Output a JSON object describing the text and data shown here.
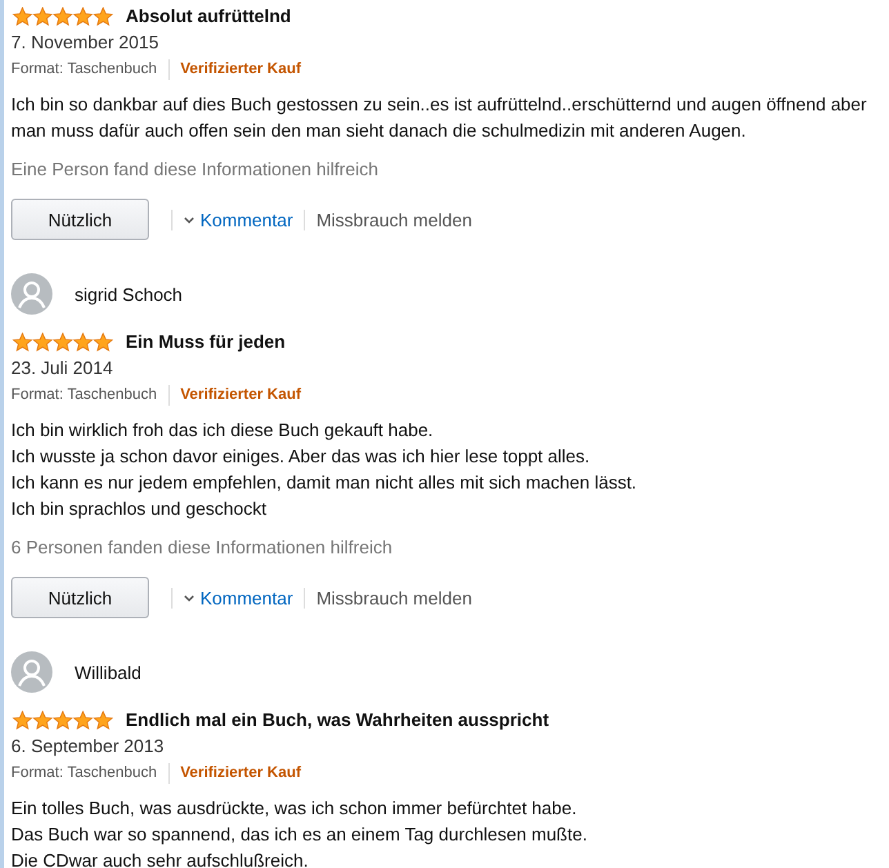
{
  "reviews": [
    {
      "stars": 5,
      "title": "Absolut aufrüttelnd",
      "date": "7. November 2015",
      "format": "Format: Taschenbuch",
      "verified": "Verifizierter Kauf",
      "body": [
        "Ich bin so dankbar auf dies Buch gestossen zu sein..es ist aufrüttelnd..erschütternd und augen öffnend aber",
        "man muss dafür auch offen sein den man sieht danach die schulmedizin mit anderen Augen."
      ],
      "helpful_text": "Eine Person fand diese Informationen hilfreich",
      "helpful_button": "Nützlich",
      "comment_link": "Kommentar",
      "report_link": "Missbrauch melden"
    },
    {
      "author": "sigrid Schoch",
      "stars": 5,
      "title": "Ein Muss für jeden",
      "date": "23. Juli 2014",
      "format": "Format: Taschenbuch",
      "verified": "Verifizierter Kauf",
      "body": [
        "Ich bin wirklich froh das ich diese Buch gekauft habe.",
        "Ich wusste ja schon davor einiges. Aber das was ich hier lese toppt alles.",
        "Ich kann es nur jedem empfehlen, damit man nicht alles mit sich machen lässt.",
        "Ich bin sprachlos und geschockt"
      ],
      "helpful_text": "6 Personen fanden diese Informationen hilfreich",
      "helpful_button": "Nützlich",
      "comment_link": "Kommentar",
      "report_link": "Missbrauch melden"
    },
    {
      "author": "Willibald",
      "stars": 5,
      "title": "Endlich mal ein Buch, was Wahrheiten ausspricht",
      "date": "6. September 2013",
      "format": "Format: Taschenbuch",
      "verified": "Verifizierter Kauf",
      "body": [
        "Ein tolles Buch, was ausdrückte, was ich schon immer befürchtet habe.",
        "Das Buch war so spannend, das ich es an einem Tag durchlesen mußte.",
        "Die CDwar auch sehr aufschlußreich."
      ]
    }
  ]
}
